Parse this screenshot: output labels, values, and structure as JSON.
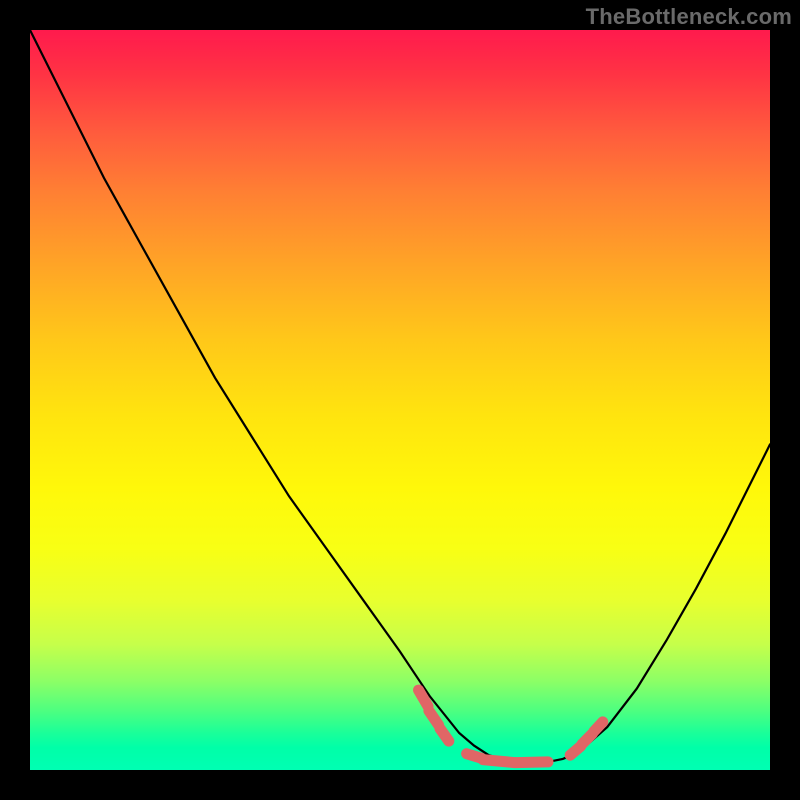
{
  "watermark": "TheBottleneck.com",
  "chart_data": {
    "type": "line",
    "title": "",
    "xlabel": "",
    "ylabel": "",
    "xlim": [
      0,
      100
    ],
    "ylim": [
      0,
      100
    ],
    "x": [
      0,
      5,
      10,
      15,
      20,
      25,
      30,
      35,
      40,
      45,
      50,
      52,
      54,
      56,
      58,
      60,
      62,
      64,
      66,
      68,
      70,
      72,
      74,
      78,
      82,
      86,
      90,
      94,
      98,
      100
    ],
    "values": [
      100,
      90,
      80,
      71,
      62,
      53,
      45,
      37,
      30,
      23,
      16,
      13,
      10,
      7.5,
      5,
      3.3,
      2,
      1.4,
      1.1,
      1.0,
      1.1,
      1.5,
      2.3,
      5.8,
      11,
      17.5,
      24.5,
      32,
      40,
      44
    ],
    "series": [
      {
        "name": "curve",
        "color": "#000000"
      },
      {
        "name": "highlight-band",
        "color": "#e06666",
        "segments": [
          {
            "x": [
              52.5,
              53.8
            ],
            "y": [
              10.8,
              8.6
            ]
          },
          {
            "x": [
              53.9,
              55.2
            ],
            "y": [
              8.0,
              6.1
            ]
          },
          {
            "x": [
              55.4,
              56.6
            ],
            "y": [
              5.6,
              3.9
            ]
          },
          {
            "x": [
              59.0,
              61.0
            ],
            "y": [
              2.2,
              1.6
            ]
          },
          {
            "x": [
              61.2,
              65.5
            ],
            "y": [
              1.4,
              1.0
            ]
          },
          {
            "x": [
              65.7,
              70.0
            ],
            "y": [
              1.0,
              1.1
            ]
          },
          {
            "x": [
              73.0,
              74.4
            ],
            "y": [
              2.0,
              3.2
            ]
          },
          {
            "x": [
              74.6,
              76.0
            ],
            "y": [
              3.5,
              4.9
            ]
          },
          {
            "x": [
              76.2,
              77.4
            ],
            "y": [
              5.2,
              6.5
            ]
          }
        ]
      }
    ]
  }
}
